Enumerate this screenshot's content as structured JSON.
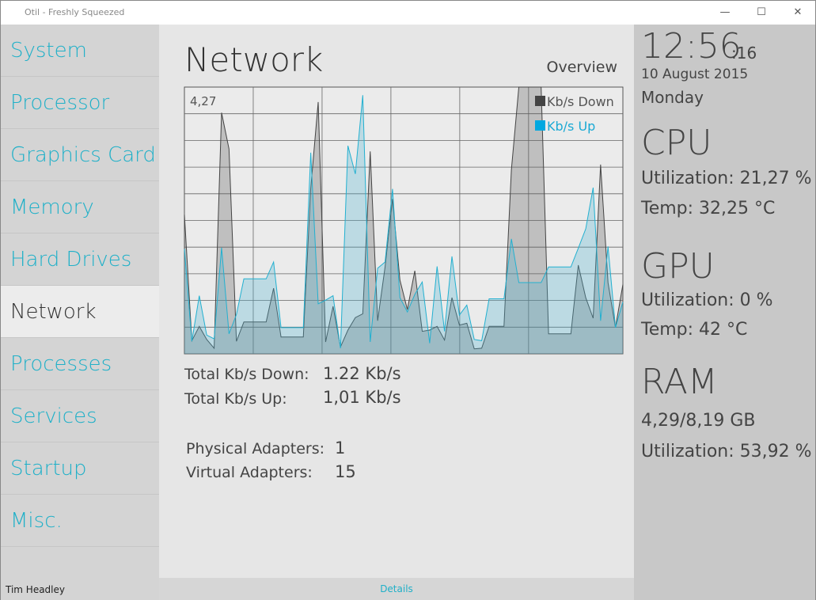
{
  "window": {
    "title": "Otil - Freshly Squeezed",
    "minimize": "—",
    "maximize": "☐",
    "close": "✕"
  },
  "sidebar": {
    "items": [
      {
        "label": "System"
      },
      {
        "label": "Processor"
      },
      {
        "label": "Graphics Card"
      },
      {
        "label": "Memory"
      },
      {
        "label": "Hard Drives"
      },
      {
        "label": "Network",
        "selected": true
      },
      {
        "label": "Processes"
      },
      {
        "label": "Services"
      },
      {
        "label": "Startup"
      },
      {
        "label": "Misc."
      }
    ],
    "user": "Tim Headley"
  },
  "main": {
    "title": "Network",
    "view": "Overview",
    "stats": {
      "down_label": "Total Kb/s Down:",
      "down_value": "1.22 Kb/s",
      "up_label": "Total Kb/s Up:",
      "up_value": "1,01 Kb/s",
      "phys_label": "Physical Adapters:",
      "phys_value": "1",
      "virt_label": "Virtual Adapters:",
      "virt_value": "15"
    },
    "details": "Details"
  },
  "chart_data": {
    "type": "area",
    "max_label": "4,27",
    "ylim": [
      0,
      4.27
    ],
    "grid": true,
    "legend": "top-right",
    "series": [
      {
        "name": "Kb/s Down",
        "color": "#444444",
        "values": [
          2.23,
          0.21,
          0.44,
          0.23,
          0.09,
          3.86,
          3.28,
          0.2,
          0.51,
          0.51,
          0.51,
          0.51,
          1.05,
          0.27,
          0.27,
          0.27,
          0.27,
          2.65,
          4.03,
          0.19,
          0.76,
          0.11,
          0.38,
          0.58,
          0.64,
          3.24,
          0.53,
          1.39,
          2.48,
          1.18,
          0.71,
          1.33,
          0.36,
          0.38,
          0.44,
          0.22,
          0.9,
          0.46,
          0.49,
          0.08,
          0.09,
          0.44,
          0.44,
          0.44,
          2.95,
          4.27,
          4.27,
          4.27,
          4.27,
          0.32,
          0.32,
          0.32,
          0.32,
          1.42,
          0.9,
          0.57,
          3.03,
          1.14,
          0.42,
          1.11
        ]
      },
      {
        "name": "Kb/s Up",
        "color": "#1aa9d4",
        "values": [
          1.68,
          0.2,
          0.93,
          0.3,
          0.24,
          1.7,
          0.32,
          0.63,
          1.2,
          1.2,
          1.2,
          1.2,
          1.47,
          0.42,
          0.42,
          0.42,
          0.42,
          3.22,
          0.8,
          0.86,
          0.93,
          0.09,
          3.33,
          2.88,
          4.14,
          0.19,
          1.37,
          1.47,
          2.64,
          0.9,
          0.67,
          0.95,
          1.15,
          0.17,
          1.4,
          0.36,
          1.56,
          0.62,
          0.78,
          0.23,
          0.21,
          0.88,
          0.88,
          0.88,
          1.84,
          1.14,
          1.14,
          1.14,
          1.14,
          1.39,
          1.39,
          1.39,
          1.39,
          1.69,
          2.0,
          2.66,
          0.53,
          1.72,
          0.42,
          0.83
        ]
      }
    ]
  },
  "panel": {
    "time": "12:56",
    "seconds": ":16",
    "date": "10 August 2015",
    "day": "Monday",
    "cpu": {
      "title": "CPU",
      "util": "Utilization: 21,27 %",
      "temp": "Temp: 32,25 °C"
    },
    "gpu": {
      "title": "GPU",
      "util": "Utilization: 0 %",
      "temp": "Temp: 42 °C"
    },
    "ram": {
      "title": "RAM",
      "usage": "4,29/8,19 GB",
      "util": "Utilization: 53,92 %"
    }
  }
}
